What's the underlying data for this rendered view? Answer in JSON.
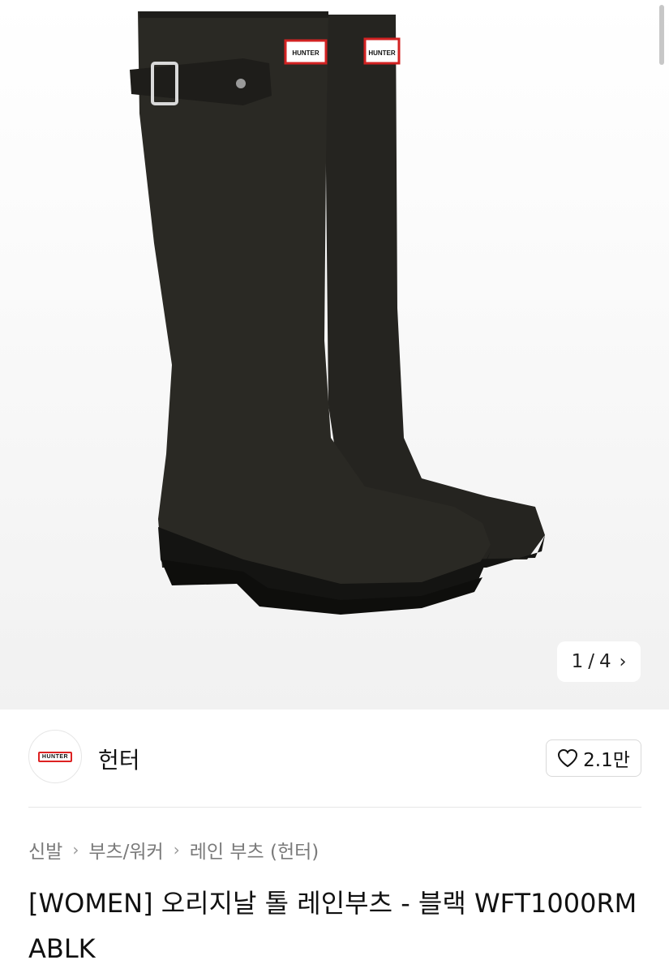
{
  "gallery": {
    "current": "1",
    "separator": "/",
    "total": "4",
    "next_icon": "chevron-right-icon",
    "boot_label_1": "HUNTER",
    "boot_label_2": "HUNTER"
  },
  "brand": {
    "logo_text": "HUNTER",
    "name": "헌터"
  },
  "like": {
    "icon": "heart-icon",
    "count": "2.1만"
  },
  "breadcrumb": {
    "items": [
      "신발",
      "부츠/워커",
      "레인 부츠 (헌터)"
    ]
  },
  "product": {
    "title": "[WOMEN] 오리지날 톨 레인부츠 - 블랙 WFT1000RMABLK"
  },
  "colors": {
    "accent_red": "#d22222",
    "boot": "#2a2924"
  }
}
